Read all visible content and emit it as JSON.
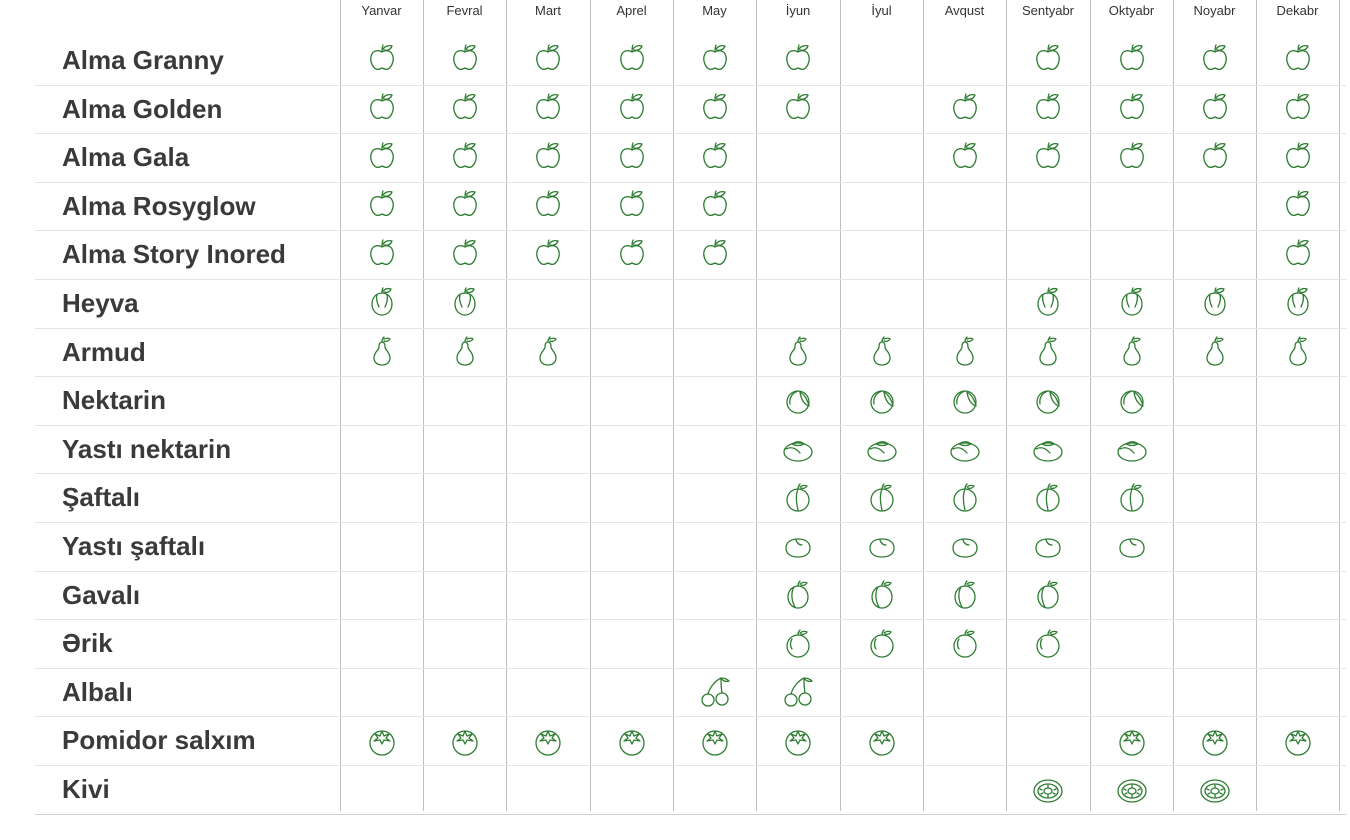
{
  "chart_data": {
    "type": "table",
    "months": [
      "Yanvar",
      "Fevral",
      "Mart",
      "Aprel",
      "May",
      "İyun",
      "İyul",
      "Avqust",
      "Sentyabr",
      "Oktyabr",
      "Noyabr",
      "Dekabr"
    ],
    "rows": [
      {
        "fruit": "Alma Granny",
        "icon": "apple-icon",
        "months": [
          1,
          1,
          1,
          1,
          1,
          1,
          0,
          0,
          1,
          1,
          1,
          1
        ]
      },
      {
        "fruit": "Alma Golden",
        "icon": "apple-icon",
        "months": [
          1,
          1,
          1,
          1,
          1,
          1,
          0,
          1,
          1,
          1,
          1,
          1
        ]
      },
      {
        "fruit": "Alma Gala",
        "icon": "apple-icon",
        "months": [
          1,
          1,
          1,
          1,
          1,
          0,
          0,
          1,
          1,
          1,
          1,
          1
        ]
      },
      {
        "fruit": "Alma Rosyglow",
        "icon": "apple-icon",
        "months": [
          1,
          1,
          1,
          1,
          1,
          0,
          0,
          0,
          0,
          0,
          0,
          1
        ]
      },
      {
        "fruit": "Alma Story Inored",
        "icon": "apple-icon",
        "months": [
          1,
          1,
          1,
          1,
          1,
          0,
          0,
          0,
          0,
          0,
          0,
          1
        ]
      },
      {
        "fruit": "Heyva",
        "icon": "quince-icon",
        "months": [
          1,
          1,
          0,
          0,
          0,
          0,
          0,
          0,
          1,
          1,
          1,
          1
        ]
      },
      {
        "fruit": "Armud",
        "icon": "pear-icon",
        "months": [
          1,
          1,
          1,
          0,
          0,
          1,
          1,
          1,
          1,
          1,
          1,
          1
        ]
      },
      {
        "fruit": "Nektarin",
        "icon": "nectarine-icon",
        "months": [
          0,
          0,
          0,
          0,
          0,
          1,
          1,
          1,
          1,
          1,
          0,
          0
        ]
      },
      {
        "fruit": "Yastı nektarin",
        "icon": "flat-nectarine-icon",
        "months": [
          0,
          0,
          0,
          0,
          0,
          1,
          1,
          1,
          1,
          1,
          0,
          0
        ]
      },
      {
        "fruit": "Şaftalı",
        "icon": "peach-icon",
        "months": [
          0,
          0,
          0,
          0,
          0,
          1,
          1,
          1,
          1,
          1,
          0,
          0
        ]
      },
      {
        "fruit": "Yastı şaftalı",
        "icon": "flat-peach-icon",
        "months": [
          0,
          0,
          0,
          0,
          0,
          1,
          1,
          1,
          1,
          1,
          0,
          0
        ]
      },
      {
        "fruit": "Gavalı",
        "icon": "plum-icon",
        "months": [
          0,
          0,
          0,
          0,
          0,
          1,
          1,
          1,
          1,
          0,
          0,
          0
        ]
      },
      {
        "fruit": "Ərik",
        "icon": "apricot-icon",
        "months": [
          0,
          0,
          0,
          0,
          0,
          1,
          1,
          1,
          1,
          0,
          0,
          0
        ]
      },
      {
        "fruit": "Albalı",
        "icon": "cherry-icon",
        "months": [
          0,
          0,
          0,
          0,
          1,
          1,
          0,
          0,
          0,
          0,
          0,
          0
        ]
      },
      {
        "fruit": "Pomidor salxım",
        "icon": "tomato-icon",
        "months": [
          1,
          1,
          1,
          1,
          1,
          1,
          1,
          0,
          0,
          1,
          1,
          1
        ]
      },
      {
        "fruit": "Kivi",
        "icon": "kiwi-icon",
        "months": [
          0,
          0,
          0,
          0,
          0,
          0,
          0,
          0,
          1,
          1,
          1,
          0
        ]
      }
    ],
    "colors": {
      "icon": "#2e7d32",
      "text": "#3a3a3a",
      "grid": "#bdbdbd",
      "row_line": "#e4e4e4"
    }
  }
}
